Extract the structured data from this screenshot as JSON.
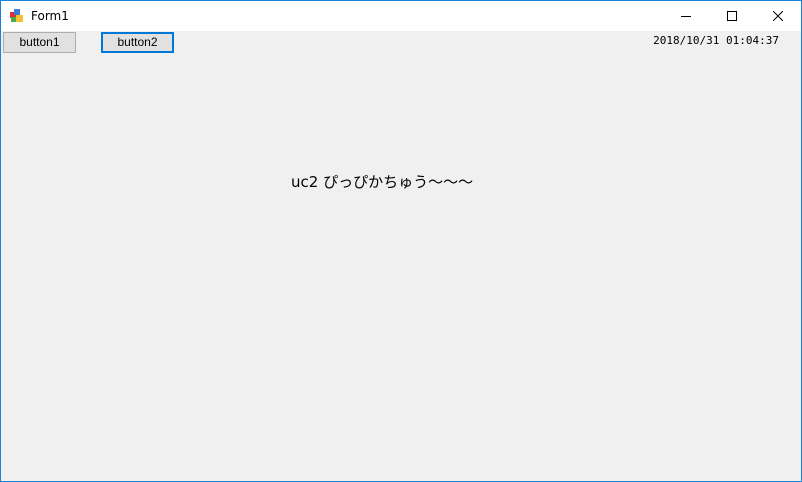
{
  "window": {
    "title": "Form1",
    "icon": "winforms-app-icon",
    "controls": {
      "minimize_icon": "minimize-icon",
      "maximize_icon": "maximize-icon",
      "close_icon": "close-icon"
    }
  },
  "toolbar": {
    "button1_label": "button1",
    "button2_label": "button2"
  },
  "status": {
    "datetime": "2018/10/31 01:04:37"
  },
  "content": {
    "label": "uc2 ぴっぴかちゅう～～～"
  },
  "colors": {
    "window_border": "#1883d7",
    "client_background": "#f0f0f0",
    "focus_border": "#0078d7"
  }
}
